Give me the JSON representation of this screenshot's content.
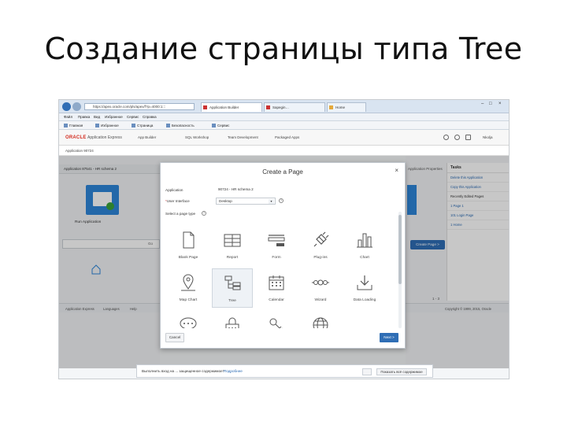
{
  "slide_title": "Создание страницы типа Tree",
  "browser": {
    "address": "https://apex.oracle.com/pls/apex/f?p=4000:1:::",
    "tabs": [
      {
        "label": "Application Builder"
      },
      {
        "label": "Sapegin…"
      },
      {
        "label": "Home"
      }
    ],
    "menu": [
      "Файл",
      "Правка",
      "Вид",
      "Избранное",
      "Сервис",
      "Справка"
    ],
    "favorites": [
      "Главная",
      "Избранное",
      "Страница",
      "Безопасность",
      "Сервис"
    ]
  },
  "apex": {
    "logo": "ORACLE",
    "product": "Application Express",
    "menu": [
      "App Builder",
      "SQL Workshop",
      "Team Development",
      "Packaged Apps"
    ],
    "user": "Nkolja",
    "crumb_app": "Application 90724",
    "page_header": "Application 87541 - HR schema 2",
    "app_properties": "Application Properties"
  },
  "background": {
    "run_label": "Run Application",
    "go": "Go",
    "create_page": "Create Page >",
    "pagination": "1 - 3",
    "bottom_left": [
      "Application Express",
      "Languages",
      "Help"
    ],
    "bottom_right": "Copyright © 1999, 2015, Oracle",
    "tasks_header": "Tasks",
    "tasks": [
      "Delete this Application",
      "Copy this Application",
      "Recently Edited Pages",
      "1 Page 1",
      "101 Login Page",
      "1 Home"
    ]
  },
  "modal": {
    "title": "Create a Page",
    "close": "×",
    "application_label": "Application",
    "application_value": "90724 - HR schema 2",
    "user_interface_label": "User Interface",
    "user_interface_value": "Desktop",
    "select_type_label": "Select a page type",
    "tiles": [
      {
        "label": "Blank Page",
        "icon": "blank-page-icon"
      },
      {
        "label": "Report",
        "icon": "report-icon"
      },
      {
        "label": "Form",
        "icon": "form-icon"
      },
      {
        "label": "Plug-ins",
        "icon": "plugin-icon"
      },
      {
        "label": "Chart",
        "icon": "chart-icon"
      },
      {
        "label": "Map Chart",
        "icon": "map-pin-icon"
      },
      {
        "label": "Tree",
        "icon": "tree-icon"
      },
      {
        "label": "Calendar",
        "icon": "calendar-icon"
      },
      {
        "label": "Wizard",
        "icon": "wizard-icon"
      },
      {
        "label": "Data Loading",
        "icon": "data-loading-icon"
      },
      {
        "label": "",
        "icon": "feedback-icon"
      },
      {
        "label": "",
        "icon": "login-icon"
      },
      {
        "label": "",
        "icon": "key-icon"
      },
      {
        "label": "",
        "icon": "globe-icon"
      }
    ],
    "cancel": "Cancel",
    "next": "Next >"
  },
  "notification": {
    "message": "Выполнить вход на ... защищенное содержимое?",
    "link": "Подробнее",
    "button": "Показать всё содержимое"
  }
}
